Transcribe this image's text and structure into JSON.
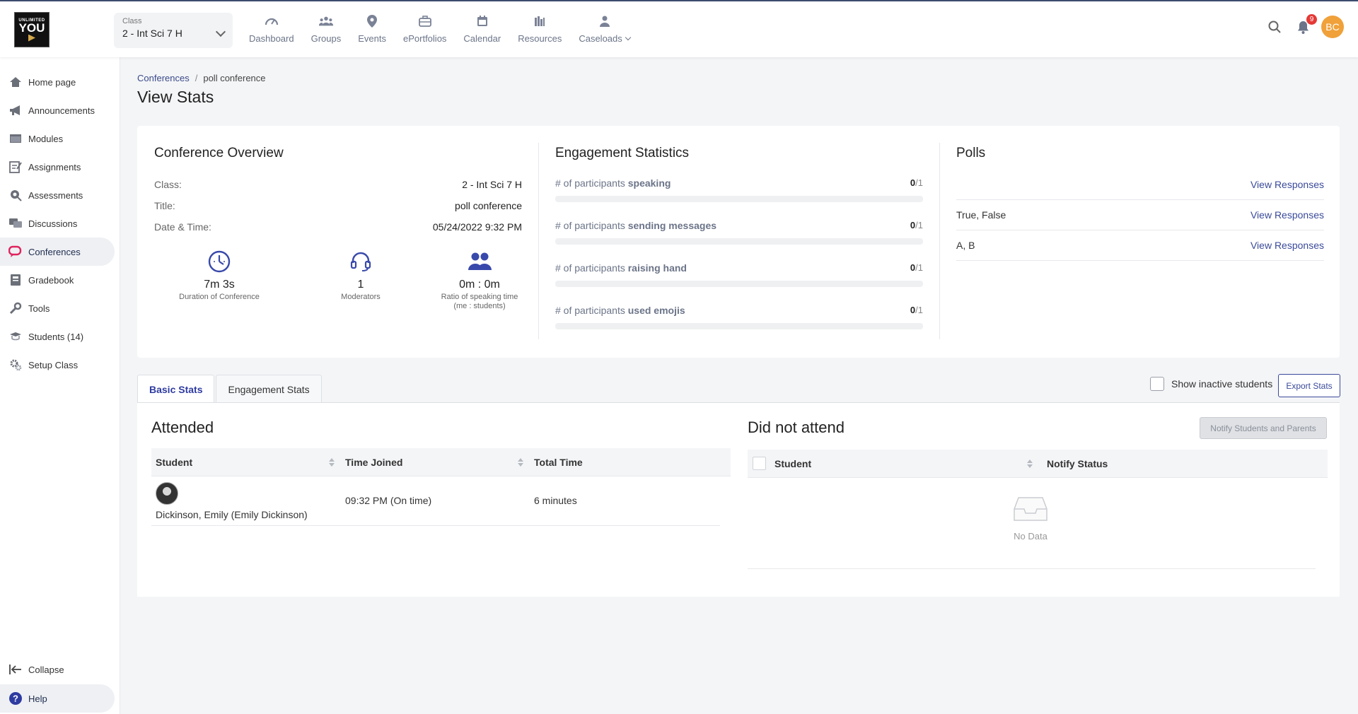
{
  "logo": {
    "line1": "UNLIMITED",
    "line2": "YOU"
  },
  "class_selector": {
    "label": "Class",
    "value": "2 - Int Sci 7 H"
  },
  "top_nav": [
    {
      "label": "Dashboard",
      "icon": "gauge-icon"
    },
    {
      "label": "Groups",
      "icon": "groups-icon"
    },
    {
      "label": "Events",
      "icon": "location-pin-icon"
    },
    {
      "label": "ePortfolios",
      "icon": "briefcase-icon"
    },
    {
      "label": "Calendar",
      "icon": "calendar-icon"
    },
    {
      "label": "Resources",
      "icon": "library-icon"
    },
    {
      "label": "Caseloads",
      "icon": "person-icon"
    }
  ],
  "header_right": {
    "notifications_count": "9",
    "avatar_initials": "BC"
  },
  "sidebar": {
    "items": [
      {
        "label": "Home page",
        "icon": "home-icon"
      },
      {
        "label": "Announcements",
        "icon": "megaphone-icon"
      },
      {
        "label": "Modules",
        "icon": "folder-icon"
      },
      {
        "label": "Assignments",
        "icon": "assignment-icon"
      },
      {
        "label": "Assessments",
        "icon": "assessment-icon"
      },
      {
        "label": "Discussions",
        "icon": "chat-icon"
      },
      {
        "label": "Conferences",
        "icon": "conference-icon"
      },
      {
        "label": "Gradebook",
        "icon": "gradebook-icon"
      },
      {
        "label": "Tools",
        "icon": "wrench-icon"
      },
      {
        "label": "Students (14)",
        "icon": "students-icon"
      },
      {
        "label": "Setup Class",
        "icon": "gear-icon"
      }
    ],
    "active_index": 6,
    "collapse_label": "Collapse",
    "help_label": "Help"
  },
  "breadcrumb": {
    "parent": "Conferences",
    "current": "poll conference"
  },
  "page_title": "View Stats",
  "overview": {
    "title": "Conference Overview",
    "fields": [
      {
        "key": "Class:",
        "value": "2 - Int Sci 7 H"
      },
      {
        "key": "Title:",
        "value": "poll conference"
      },
      {
        "key": "Date & Time:",
        "value": "05/24/2022 9:32 PM"
      }
    ],
    "stats": [
      {
        "value": "7m 3s",
        "caption": "Duration of Conference",
        "icon": "clock-icon"
      },
      {
        "value": "1",
        "caption": "Moderators",
        "icon": "headset-icon"
      },
      {
        "value": "0m : 0m",
        "caption": "Ratio of speaking time",
        "caption2": "(me : students)",
        "icon": "people-icon"
      }
    ]
  },
  "engagement": {
    "title": "Engagement Statistics",
    "rows": [
      {
        "prefix": "# of participants",
        "bold": "speaking",
        "count": "0",
        "total": "1",
        "fraction": 0
      },
      {
        "prefix": "# of participants",
        "bold": "sending messages",
        "count": "0",
        "total": "1",
        "fraction": 0
      },
      {
        "prefix": "# of participants",
        "bold": "raising hand",
        "count": "0",
        "total": "1",
        "fraction": 0
      },
      {
        "prefix": "# of participants",
        "bold": "used emojis",
        "count": "0",
        "total": "1",
        "fraction": 0
      }
    ]
  },
  "polls": {
    "title": "Polls",
    "rows": [
      {
        "name": "",
        "link": "View Responses"
      },
      {
        "name": "True, False",
        "link": "View Responses"
      },
      {
        "name": "A, B",
        "link": "View Responses"
      }
    ]
  },
  "tabs": [
    {
      "label": "Basic Stats",
      "active": true
    },
    {
      "label": "Engagement Stats",
      "active": false
    }
  ],
  "show_inactive_label": "Show inactive students",
  "export_label": "Export Stats",
  "attended": {
    "title": "Attended",
    "columns": [
      "Student",
      "Time Joined",
      "Total Time"
    ],
    "rows": [
      {
        "student": "Dickinson, Emily (Emily Dickinson)",
        "time_joined": "09:32 PM (On time)",
        "total_time": "6 minutes"
      }
    ]
  },
  "not_attended": {
    "title": "Did not attend",
    "notify_label": "Notify Students and Parents",
    "columns": [
      "Student",
      "Notify Status"
    ],
    "empty_text": "No Data"
  }
}
